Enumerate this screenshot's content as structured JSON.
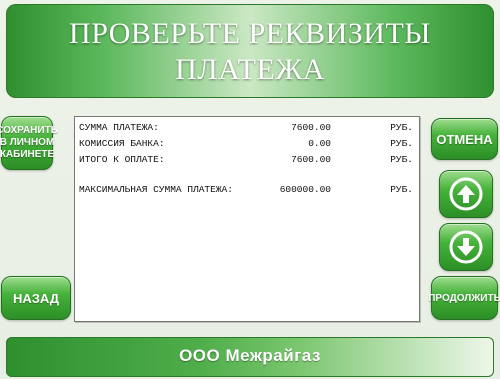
{
  "header": {
    "title_line1": "ПРОВЕРЬТЕ РЕКВИЗИТЫ",
    "title_line2": "ПЛАТЕЖА"
  },
  "buttons": {
    "save_label": "СОХРАНИТЬ В ЛИЧНОМ КАБИНЕТЕ",
    "back_label": "НАЗАД",
    "cancel_label": "ОТМЕНА",
    "forward_label": "ПРОДОЛЖИТЬ",
    "up_icon": "arrow-up-icon",
    "down_icon": "arrow-down-icon"
  },
  "receipt": {
    "rows": [
      {
        "label": "СУММА ПЛАТЕЖА:",
        "value": "7600.00",
        "currency": "РУБ."
      },
      {
        "label": "КОМИССИЯ БАНКА:",
        "value": "0.00",
        "currency": "РУБ."
      },
      {
        "label": "ИТОГО К ОПЛАТЕ:",
        "value": "7600.00",
        "currency": "РУБ."
      },
      {
        "label": "МАКСИМАЛЬНАЯ СУММА ПЛАТЕЖА:",
        "value": "600000.00",
        "currency": "РУБ."
      }
    ]
  },
  "footer": {
    "company": "ООО Межрайгаз"
  },
  "colors": {
    "brand_green": "#2f8f2f",
    "button_green": "#46b23b",
    "panel_bg": "#ffffff"
  }
}
